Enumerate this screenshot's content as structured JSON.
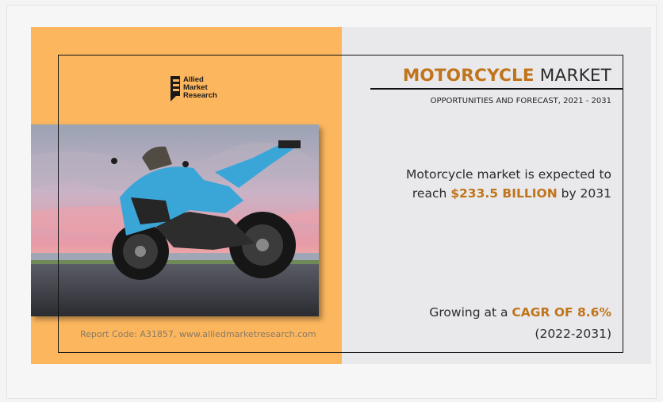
{
  "colors": {
    "orange_panel": "#fbb65e",
    "accent": "#c0741b",
    "gray_panel": "#e9e9eb"
  },
  "logo": {
    "line1": "Allied",
    "line2": "Market",
    "line3": "Research"
  },
  "header": {
    "title_highlight": "MOTORCYCLE",
    "title_rest": " MARKET",
    "subtitle": "OPPORTUNITIES AND FORECAST, 2021 - 2031"
  },
  "stat_value": {
    "line1": "Motorcycle market is expected to",
    "prefix": "reach ",
    "value": "$233.5 BILLION",
    "suffix": " by 2031"
  },
  "stat_cagr": {
    "prefix": "Growing at a ",
    "value": "CAGR OF 8.6%",
    "period": "(2022-2031)"
  },
  "footer": {
    "report_code": "Report Code: A31857, www.alliedmarketresearch.com"
  },
  "image": {
    "subject": "blue-sport-motorcycle-photo"
  }
}
